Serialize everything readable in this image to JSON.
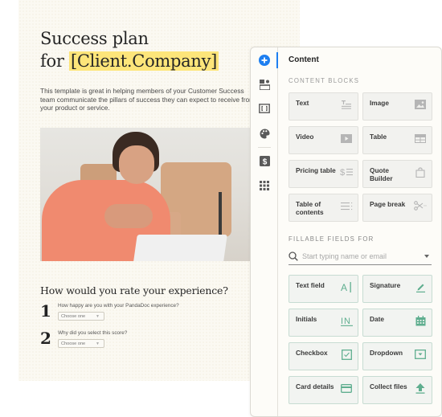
{
  "document": {
    "title_line1": "Success plan",
    "title_line2_prefix": "for ",
    "title_variable": "[Client.Company]",
    "intro_lines": [
      "This template is great in helping members of your Customer Success",
      "team communicate the pillars of success they can expect to receive from",
      "your product or service."
    ],
    "hero_image": "woman-making-heart-hands-at-laptop",
    "rating_title": "How would you rate your experience?",
    "questions": [
      {
        "number": "1",
        "text": "How happy are you with your PandaDoc experience?",
        "select_value": "Choose one"
      },
      {
        "number": "2",
        "text": "Why did you select this score?",
        "select_value": "Choose one"
      }
    ]
  },
  "panel": {
    "rail": [
      {
        "name": "add-content",
        "icon": "plus-circle-icon",
        "active": true
      },
      {
        "name": "fields",
        "icon": "blocks-icon"
      },
      {
        "name": "variables",
        "icon": "brackets-icon"
      },
      {
        "name": "design",
        "icon": "palette-icon"
      },
      {
        "name": "pricing",
        "icon": "dollar-icon"
      },
      {
        "name": "apps",
        "icon": "grid-icon"
      }
    ],
    "title": "Content",
    "content_blocks_label": "CONTENT BLOCKS",
    "content_blocks": [
      {
        "label": "Text",
        "icon": "text-icon"
      },
      {
        "label": "Image",
        "icon": "image-icon"
      },
      {
        "label": "Video",
        "icon": "video-icon"
      },
      {
        "label": "Table",
        "icon": "table-icon"
      },
      {
        "label": "Pricing table",
        "icon": "pricing-table-icon"
      },
      {
        "label": "Quote Builder",
        "icon": "quote-builder-icon"
      },
      {
        "label": "Table of contents",
        "icon": "table-of-contents-icon"
      },
      {
        "label": "Page break",
        "icon": "scissors-icon"
      }
    ],
    "fillable_label": "FILLABLE FIELDS FOR",
    "search_placeholder": "Start typing name or email",
    "fillable_fields": [
      {
        "label": "Text field",
        "icon": "text-field-icon"
      },
      {
        "label": "Signature",
        "icon": "signature-icon"
      },
      {
        "label": "Initials",
        "icon": "initials-icon"
      },
      {
        "label": "Date",
        "icon": "calendar-icon"
      },
      {
        "label": "Checkbox",
        "icon": "checkbox-icon"
      },
      {
        "label": "Dropdown",
        "icon": "dropdown-icon"
      },
      {
        "label": "Card details",
        "icon": "card-icon"
      },
      {
        "label": "Collect files",
        "icon": "upload-icon"
      }
    ],
    "colors": {
      "accent": "#1e7ff0",
      "field_icon": "#5fae8f",
      "block_icon": "#b5b5b5",
      "highlight": "#fde57a"
    }
  }
}
